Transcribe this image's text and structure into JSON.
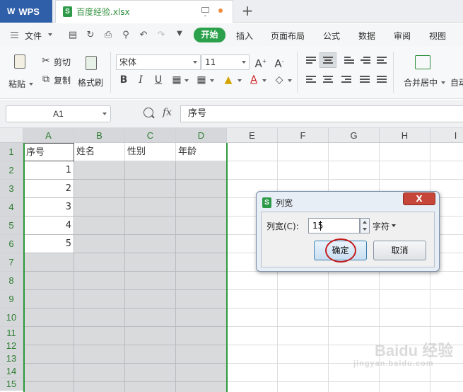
{
  "titlebar": {
    "app_tab": "WPS",
    "doc_tab": "百度经验.xlsx",
    "new_tab_symbol": "+"
  },
  "menu": {
    "file": "文件",
    "tabs": [
      "开始",
      "插入",
      "页面布局",
      "公式",
      "数据",
      "审阅",
      "视图"
    ]
  },
  "ribbon": {
    "paste": "粘贴",
    "cut": "剪切",
    "copy": "复制",
    "format_painter": "格式刷",
    "font_name": "宋体",
    "font_size": "11",
    "merge_center": "合并居中",
    "auto": "自动"
  },
  "formula_bar": {
    "cell_ref": "A1",
    "fx": "fx",
    "content": "序号"
  },
  "grid": {
    "columns": [
      "A",
      "B",
      "C",
      "D",
      "E",
      "F",
      "G",
      "H",
      "I"
    ],
    "rows": [
      "1",
      "2",
      "3",
      "4",
      "5",
      "6",
      "7",
      "8",
      "9",
      "10",
      "11",
      "12",
      "13",
      "14",
      "15"
    ],
    "headers": [
      "序号",
      "姓名",
      "性别",
      "年龄"
    ],
    "serials": [
      "1",
      "2",
      "3",
      "4",
      "5"
    ]
  },
  "dialog": {
    "title": "列宽",
    "close": "X",
    "label": "列宽(C):",
    "value": "15",
    "unit": "字符",
    "ok": "确定",
    "cancel": "取消"
  },
  "watermark": {
    "text": "Baidu 经验",
    "sub": "jingyan.baidu.com"
  },
  "colors": {
    "accent_green": "#2aa14a",
    "wps_blue": "#2f5fa8",
    "selection_border": "#2e9a3e",
    "highlight_red": "#c61b1b"
  }
}
